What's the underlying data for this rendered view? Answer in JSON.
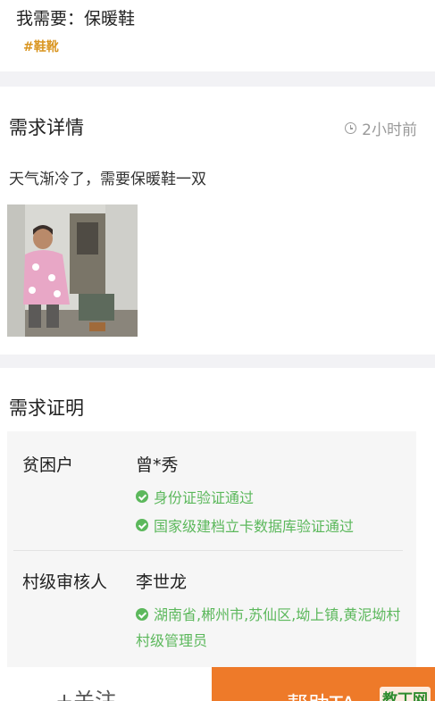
{
  "header": {
    "title": "我需要：保暖鞋",
    "tag": "#鞋靴"
  },
  "detail": {
    "section_title": "需求详情",
    "time": "2小时前",
    "time_icon": "clock-icon",
    "description": "天气渐冷了，需要保暖鞋一双"
  },
  "proof": {
    "section_title": "需求证明",
    "poor_label": "贫困户",
    "poor_name": "曾*秀",
    "checks": [
      "身份证验证通过",
      "国家级建档立卡数据库验证通过"
    ],
    "reviewer_label": "村级审核人",
    "reviewer_name": "李世龙",
    "reviewer_info": "湖南省,郴州市,苏仙区,坳上镇,黄泥坳村 村级管理员",
    "check_icon": "check-circle-icon",
    "check_color": "#5cb85c"
  },
  "bottom": {
    "follow_label": "+关注",
    "help_label": "帮助TA",
    "watermark": "教丁网",
    "help_color": "#ee7a29"
  }
}
